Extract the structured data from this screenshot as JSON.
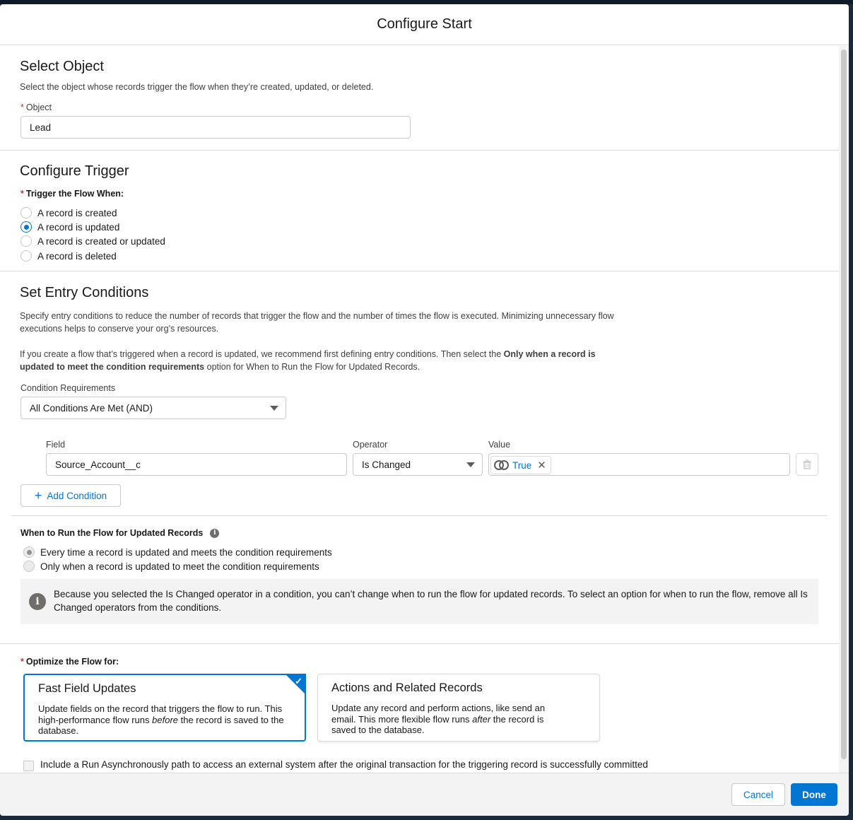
{
  "modal": {
    "title": "Configure Start"
  },
  "select_object": {
    "heading": "Select Object",
    "description": "Select the object whose records trigger the flow when they’re created, updated, or deleted.",
    "required_mark": "*",
    "object_label": "Object",
    "object_value": "Lead"
  },
  "configure_trigger": {
    "heading": "Configure Trigger",
    "required_mark": "*",
    "label": "Trigger the Flow When:",
    "options": [
      {
        "label": "A record is created",
        "selected": false
      },
      {
        "label": "A record is updated",
        "selected": true
      },
      {
        "label": "A record is created or updated",
        "selected": false
      },
      {
        "label": "A record is deleted",
        "selected": false
      }
    ]
  },
  "entry_conditions": {
    "heading": "Set Entry Conditions",
    "description_1": "Specify entry conditions to reduce the number of records that trigger the flow and the number of times the flow is executed. Minimizing unnecessary flow executions helps to conserve your org’s resources.",
    "description_2_a": "If you create a flow that’s triggered when a record is updated, we recommend first defining entry conditions. Then select the ",
    "description_2_bold": "Only when a record is updated to meet the condition requirements",
    "description_2_b": " option for When to Run the Flow for Updated Records.",
    "requirements_label": "Condition Requirements",
    "requirements_value": "All Conditions Are Met (AND)",
    "columns": {
      "field": "Field",
      "operator": "Operator",
      "value": "Value"
    },
    "condition": {
      "field": "Source_Account__c",
      "operator": "Is Changed",
      "value": "True"
    },
    "add_condition": "Add Condition"
  },
  "when_to_run": {
    "label": "When to Run the Flow for Updated Records",
    "options": [
      {
        "label": "Every time a record is updated and meets the condition requirements",
        "selected": true
      },
      {
        "label": "Only when a record is updated to meet the condition requirements",
        "selected": false
      }
    ],
    "info": "Because you selected the Is Changed operator in a condition, you can’t change when to run the flow for updated records. To select an option for when to run the flow, remove all Is Changed operators from the conditions."
  },
  "optimize": {
    "required_mark": "*",
    "label": "Optimize the Flow for:",
    "cards": [
      {
        "title": "Fast Field Updates",
        "desc_a": "Update fields on the record that triggers the flow to run. This high-performance flow runs ",
        "desc_em": "before",
        "desc_b": " the record is saved to the database.",
        "selected": true
      },
      {
        "title": "Actions and Related Records",
        "desc_a": "Update any record and perform actions, like send an email. This more flexible flow runs ",
        "desc_em": "after",
        "desc_b": " the record is saved to the database.",
        "selected": false
      }
    ],
    "async_label": "Include a Run Asynchronously path to access an external system after the original transaction for the triggering record is successfully committed"
  },
  "footer": {
    "cancel": "Cancel",
    "done": "Done"
  },
  "colors": {
    "brand": "#0176d3",
    "required": "#c23934"
  }
}
